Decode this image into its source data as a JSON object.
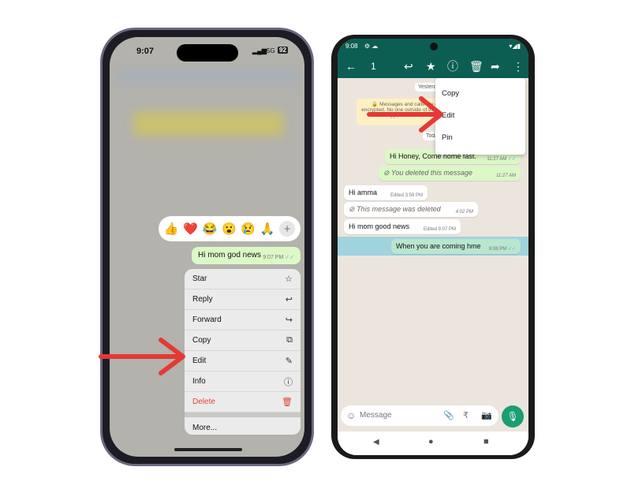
{
  "iphone": {
    "time": "9:07",
    "network": "5G",
    "battery": "92",
    "reactions": [
      "👍",
      "❤️",
      "😂",
      "😮",
      "😢",
      "🙏"
    ],
    "reaction_more": "+",
    "message": {
      "text": "Hi mom god news",
      "time": "9:07 PM"
    },
    "menu": [
      {
        "label": "Star",
        "icon": "☆"
      },
      {
        "label": "Reply",
        "icon": "↩"
      },
      {
        "label": "Forward",
        "icon": "↪"
      },
      {
        "label": "Copy",
        "icon": "⧉"
      },
      {
        "label": "Edit",
        "icon": "✎"
      },
      {
        "label": "Info",
        "icon": "ⓘ"
      },
      {
        "label": "Delete",
        "icon": "🗑"
      }
    ],
    "more": "More..."
  },
  "android": {
    "status_time": "9:08",
    "selected_count": "1",
    "menu": [
      "Copy",
      "Edit",
      "Pin"
    ],
    "date_yesterday": "Yesterday",
    "date_today": "Today",
    "encryption_notice": "🔒 Messages and calls are end-to-end encrypted. No one outside of this chat, not even WhatsApp, can read or listen to them.",
    "messages": [
      {
        "text": "Hi Honey, Come nome fast.",
        "time": "11:27 AM",
        "dir": "out"
      },
      {
        "text": "You deleted this message",
        "time": "11:27 AM",
        "dir": "out",
        "deleted": true
      },
      {
        "text": "Hi amma",
        "time": "Edited 3:58 PM",
        "dir": "in"
      },
      {
        "text": "This message was deleted",
        "time": "4:02 PM",
        "dir": "in",
        "deleted": true
      },
      {
        "text": "Hi mom good news",
        "time": "Edited 9:07 PM",
        "dir": "in"
      },
      {
        "text": "When you are coming hme",
        "time": "9:08 PM",
        "dir": "out",
        "selected": true
      }
    ],
    "composer_placeholder": "Message"
  },
  "colors": {
    "whatsapp_green": "#0c5e52",
    "bubble_out": "#dcf8c6",
    "arrow": "#e53935",
    "delete": "#e0443b",
    "selected": "#9fd3dd"
  }
}
